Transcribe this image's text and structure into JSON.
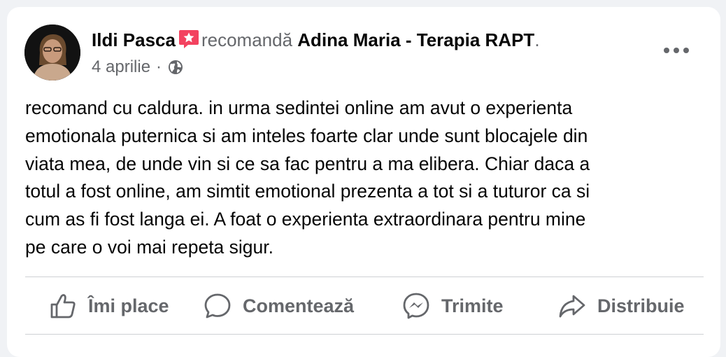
{
  "post": {
    "author": "Ildi Pasca",
    "recommends_text": "recomandă",
    "page_name": "Adina Maria - Terapia RAPT",
    "period": ".",
    "date": "4 aprilie",
    "separator": "·",
    "audience_icon": "globe-icon",
    "recommend_icon": "recommend-star-icon",
    "more_icon": "more-dots-icon",
    "body": "recomand cu caldura. in urma sedintei online am avut o experienta\nemotionala puternica si am inteles foarte clar unde sunt blocajele din\nviata mea, de unde vin si ce sa fac pentru a ma elibera. Chiar daca a\ntotul a fost online, am simtit emotional prezenta a tot si a tuturor ca si\ncum as fi fost langa ei. A foat o experienta extraordinara pentru mine\npe care o voi mai repeta sigur."
  },
  "actions": [
    {
      "label": "Îmi place",
      "icon": "thumbs-up-icon"
    },
    {
      "label": "Comentează",
      "icon": "comment-icon"
    },
    {
      "label": "Trimite",
      "icon": "messenger-icon"
    },
    {
      "label": "Distribuie",
      "icon": "share-icon"
    }
  ],
  "colors": {
    "background": "#f0f2f5",
    "card": "#ffffff",
    "primary_text": "#050505",
    "secondary_text": "#65676b",
    "recommend_badge": "#f3425f"
  }
}
